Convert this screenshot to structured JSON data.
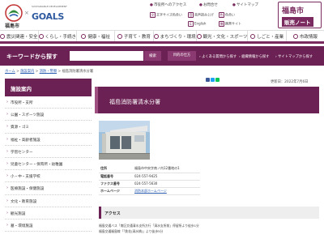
{
  "header": {
    "city_name": "福島市",
    "sdg_small": "SUSTAINABLE DEVELOPMENT",
    "sdg_goals": "GOALS",
    "sdg_x": "×",
    "top_links": [
      "市役所へのアクセス",
      "お問合せ",
      "サイトマップ"
    ],
    "utils": [
      {
        "icon": "文",
        "label": "文字サイズ色合い"
      },
      {
        "icon": "音",
        "label": "音声読み上げ"
      },
      {
        "icon": "色",
        "label": "色合い"
      },
      {
        "icon": "E",
        "label": "English"
      },
      {
        "icon": "携",
        "label": "携帯サイト"
      }
    ],
    "brand_title": "福島市",
    "brand_sub": "販売ノート",
    "colors": {
      "primary": "#6b2153",
      "accent": "#7a2a5e",
      "link": "#2a5db0"
    }
  },
  "nav": [
    "震災関連・安全",
    "くらし・手続き",
    "健康・福祉",
    "子育て・教育",
    "まちづくり・環境",
    "観光・文化・スポーツ",
    "しごと・産業",
    "市政情報"
  ],
  "search": {
    "label": "キーワードから探す",
    "placeholder": "",
    "button": "検索",
    "helper": "目的の仕方",
    "links": [
      "よくある質問から探す",
      "組織情報から探す",
      "サイトマップから探す"
    ]
  },
  "breadcrumb": [
    "ホーム",
    "施設案内",
    "消防・警察",
    "福島消防署清水分署"
  ],
  "updated": "更新日：2022年7月6日",
  "sidebar": {
    "heading": "施設案内",
    "items": [
      "市役所・支所",
      "公園・スポーツ施設",
      "資源・ゴミ",
      "福祉・高齢者施設",
      "学習センター",
      "児童センター・保育所・幼稚園",
      "小・中・支援学校",
      "医療施設・保健施設",
      "文化・教育施設",
      "観光施設",
      "墓・環境施設"
    ]
  },
  "main": {
    "title": "福島消防署清水分署",
    "info": [
      {
        "label": "住所",
        "value": "福島市中央字南ノ内12番地の1",
        "link": false
      },
      {
        "label": "電話番号",
        "value": "024-557-9425",
        "link": false
      },
      {
        "label": "ファクス番号",
        "value": "024-557-5630",
        "link": false
      },
      {
        "label": "ホームページ",
        "value": "消防本部ホームページ",
        "link": true
      }
    ],
    "access_heading": "アクセス",
    "access_lines": [
      "福島交通バス「南区交通清水支所方行「清水支所前」停留所より徒歩1分",
      "福島交通福島線「「鉄花(清水橋)」より徒歩5分"
    ]
  }
}
